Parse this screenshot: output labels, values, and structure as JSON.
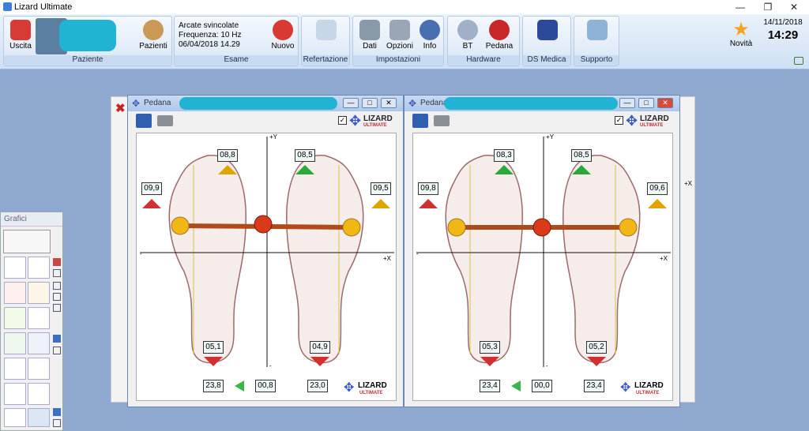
{
  "app": {
    "title": "Lizard Ultimate"
  },
  "ribbon": {
    "uscita": "Uscita",
    "pazienti": "Pazienti",
    "paziente_group": "Paziente",
    "exam_lines": [
      "Arcate svincolate",
      "Frequenza: 10 Hz",
      "06/04/2018 14.29"
    ],
    "nuovo": "Nuovo",
    "esame_group": "Esame",
    "refertazione": "Refertazione",
    "dati": "Dati",
    "opzioni": "Opzioni",
    "info": "Info",
    "impostazioni_group": "Impostazioni",
    "bt": "BT",
    "pedana": "Pedana",
    "hardware_group": "Hardware",
    "ds_medica": "DS Medica",
    "supporto": "Supporto",
    "novita": "Novità",
    "date": "14/11/2018",
    "time": "14:29"
  },
  "grafici": {
    "title": "Grafici"
  },
  "win_left": {
    "title": "Pedana",
    "brand": "LIZARD",
    "brand_sub": "ULTIMATE",
    "axis": {
      "x": "+X",
      "y": "+Y",
      "minus": "-"
    },
    "values": {
      "top_left": "08,8",
      "top_right": "08,5",
      "mid_left": "09,9",
      "mid_right": "09,5",
      "bot_left": "05,1",
      "bot_right": "04,9",
      "foot_left": "23,8",
      "foot_center": "00,8",
      "foot_right": "23,0"
    },
    "colors": {
      "top_left": "#e0a400",
      "top_right": "#2aa838",
      "mid_left": "#d03030",
      "mid_right": "#e0a400",
      "bot_left": "#d03030",
      "bot_right": "#d03030"
    }
  },
  "win_right": {
    "title": "Pedana",
    "brand": "LIZARD",
    "brand_sub": "ULTIMATE",
    "axis": {
      "x": "+X",
      "y": "+Y",
      "minus": "-"
    },
    "values": {
      "top_left": "08,3",
      "top_right": "08,5",
      "mid_left": "09,8",
      "mid_right": "09,6",
      "bot_left": "05,3",
      "bot_right": "05,2",
      "foot_left": "23,4",
      "foot_center": "00,0",
      "foot_right": "23,4"
    },
    "colors": {
      "top_left": "#2aa838",
      "top_right": "#2aa838",
      "mid_left": "#d03030",
      "mid_right": "#e0a400",
      "bot_left": "#d03030",
      "bot_right": "#d03030"
    }
  },
  "behind": {
    "x_label": "+X"
  }
}
